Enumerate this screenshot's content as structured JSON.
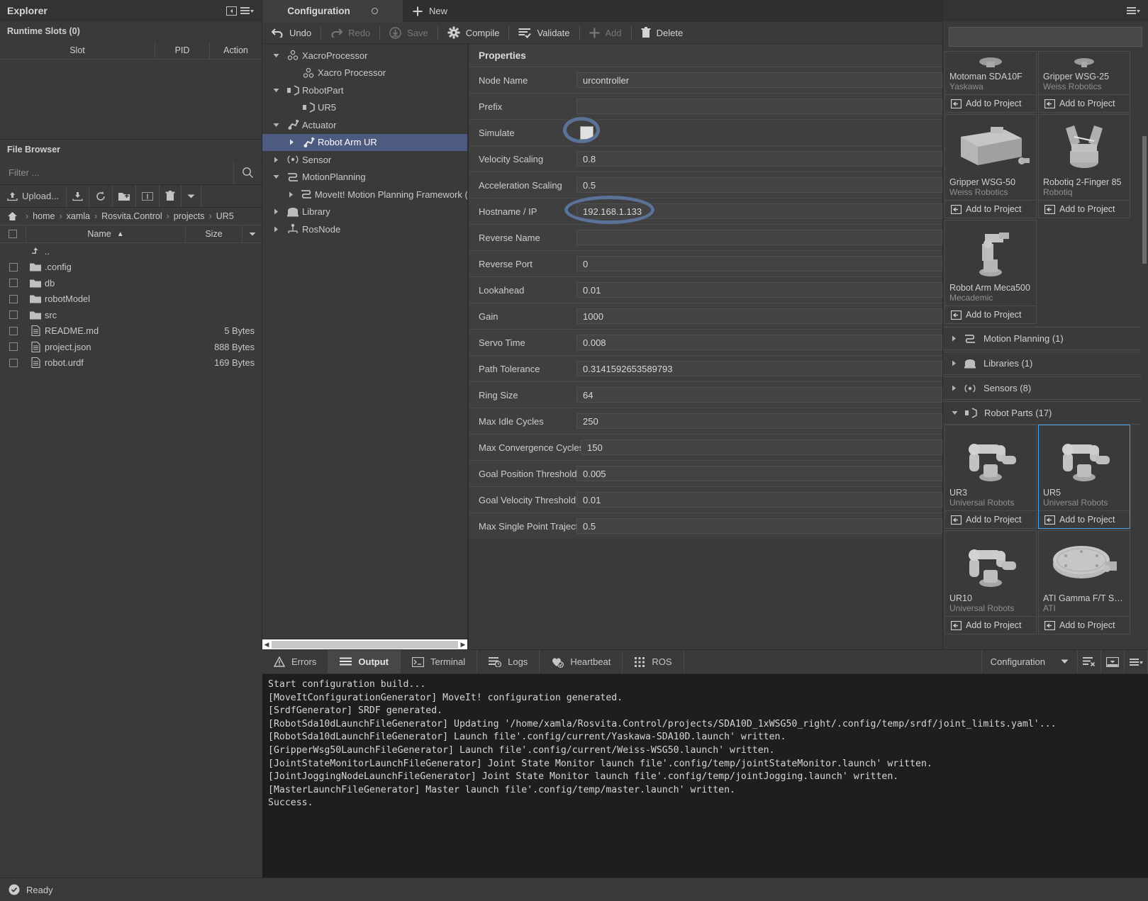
{
  "explorer": {
    "title": "Explorer",
    "collapse_icon": "collapse-panel-icon",
    "menu_icon": "hamburger-menu-icon",
    "runtime_slots": {
      "title": "Runtime Slots (0)",
      "columns": [
        "Slot",
        "PID",
        "Action"
      ],
      "rows": []
    },
    "file_browser": {
      "title": "File Browser",
      "filter_placeholder": "Filter ...",
      "toolbar": {
        "upload_label": "Upload...",
        "icons": [
          "upload-icon",
          "download-icon",
          "refresh-icon",
          "new-folder-icon",
          "rename-icon",
          "delete-icon",
          "chevron-down-icon"
        ]
      },
      "breadcrumb": [
        "home",
        "xamla",
        "Rosvita.Control",
        "projects",
        "UR5"
      ],
      "columns": [
        "Name",
        "Size"
      ],
      "sort_indicator": "▲",
      "rows": [
        {
          "name": "..",
          "size": "",
          "kind": "up"
        },
        {
          "name": ".config",
          "size": "",
          "kind": "folder"
        },
        {
          "name": "db",
          "size": "",
          "kind": "folder"
        },
        {
          "name": "robotModel",
          "size": "",
          "kind": "folder"
        },
        {
          "name": "src",
          "size": "",
          "kind": "folder"
        },
        {
          "name": "README.md",
          "size": "5 Bytes",
          "kind": "file"
        },
        {
          "name": "project.json",
          "size": "888 Bytes",
          "kind": "file"
        },
        {
          "name": "robot.urdf",
          "size": "169 Bytes",
          "kind": "file"
        }
      ]
    }
  },
  "tabs": {
    "items": [
      {
        "label": "Configuration",
        "modified": true
      }
    ],
    "new_label": "New"
  },
  "toolbar": {
    "items": [
      {
        "label": "Undo",
        "icon": "undo-icon",
        "disabled": false
      },
      {
        "label": "Redo",
        "icon": "redo-icon",
        "disabled": true
      },
      {
        "label": "Save",
        "icon": "save-icon",
        "disabled": true
      },
      {
        "label": "Compile",
        "icon": "compile-icon",
        "disabled": false
      },
      {
        "label": "Validate",
        "icon": "validate-icon",
        "disabled": false
      },
      {
        "label": "Add",
        "icon": "add-icon",
        "disabled": true
      },
      {
        "label": "Delete",
        "icon": "delete-icon",
        "disabled": false
      }
    ]
  },
  "tree": {
    "nodes": [
      {
        "label": "XacroProcessor",
        "icon": "xacro-icon",
        "indent": 0,
        "twisty": "down",
        "selected": false
      },
      {
        "label": "Xacro Processor",
        "icon": "xacro-icon",
        "indent": 1,
        "twisty": "none",
        "selected": false
      },
      {
        "label": "RobotPart",
        "icon": "robot-part-icon",
        "indent": 0,
        "twisty": "down",
        "selected": false
      },
      {
        "label": "UR5",
        "icon": "robot-part-icon",
        "indent": 1,
        "twisty": "none",
        "selected": false
      },
      {
        "label": "Actuator",
        "icon": "actuator-icon",
        "indent": 0,
        "twisty": "down",
        "selected": false
      },
      {
        "label": "Robot Arm UR",
        "icon": "actuator-icon",
        "indent": 1,
        "twisty": "right",
        "selected": true
      },
      {
        "label": "Sensor",
        "icon": "sensor-icon",
        "indent": 0,
        "twisty": "right",
        "selected": false
      },
      {
        "label": "MotionPlanning",
        "icon": "motion-planning-icon",
        "indent": 0,
        "twisty": "down",
        "selected": false
      },
      {
        "label": "MoveIt! Motion Planning Framework (RO",
        "icon": "motion-planning-icon",
        "indent": 1,
        "twisty": "right",
        "selected": false
      },
      {
        "label": "Library",
        "icon": "library-icon",
        "indent": 0,
        "twisty": "right",
        "selected": false
      },
      {
        "label": "RosNode",
        "icon": "rosnode-icon",
        "indent": 0,
        "twisty": "right",
        "selected": false
      }
    ]
  },
  "properties": {
    "title": "Properties",
    "rows": [
      {
        "label": "Node Name",
        "value": "urcontroller",
        "type": "text"
      },
      {
        "label": "Prefix",
        "value": "",
        "type": "text"
      },
      {
        "label": "Simulate",
        "value": "",
        "type": "checkbox",
        "checked": false
      },
      {
        "label": "Velocity Scaling",
        "value": "0.8",
        "type": "text"
      },
      {
        "label": "Acceleration Scaling",
        "value": "0.5",
        "type": "text"
      },
      {
        "label": "Hostname / IP",
        "value": "192.168.1.133",
        "type": "text"
      },
      {
        "label": "Reverse Name",
        "value": "",
        "type": "text"
      },
      {
        "label": "Reverse Port",
        "value": "0",
        "type": "text"
      },
      {
        "label": "Lookahead",
        "value": "0.01",
        "type": "text"
      },
      {
        "label": "Gain",
        "value": "1000",
        "type": "text"
      },
      {
        "label": "Servo Time",
        "value": "0.008",
        "type": "text"
      },
      {
        "label": "Path Tolerance",
        "value": "0.3141592653589793",
        "type": "text"
      },
      {
        "label": "Ring Size",
        "value": "64",
        "type": "text"
      },
      {
        "label": "Max Idle Cycles",
        "value": "250",
        "type": "text"
      },
      {
        "label": "Max Convergence Cycles",
        "value": "150",
        "type": "text"
      },
      {
        "label": "Goal Position Threshold (r",
        "value": "0.005",
        "type": "text"
      },
      {
        "label": "Goal Velocity Threshold (ra",
        "value": "0.01",
        "type": "text"
      },
      {
        "label": "Max Single Point Trajector",
        "value": "0.5",
        "type": "text"
      }
    ]
  },
  "annotations": {
    "accent_color": "#5a7198",
    "marks": [
      "simulate-checkbox-highlight",
      "hostname-ip-highlight"
    ]
  },
  "library": {
    "menu_icon": "hamburger-menu-icon",
    "search_value": "",
    "search_placeholder": "",
    "add_label": "Add to Project",
    "cards_top": [
      {
        "name": "Motoman SDA10F",
        "vendor": "Yaskawa",
        "thumb": "robot-arm-thumb",
        "clipped": true,
        "selected": false
      },
      {
        "name": "Gripper WSG-25",
        "vendor": "Weiss Robotics",
        "thumb": "gripper-thumb",
        "clipped": true,
        "selected": false
      },
      {
        "name": "Gripper WSG-50",
        "vendor": "Weiss Robotics",
        "thumb": "gripper-box-thumb",
        "clipped": false,
        "selected": false
      },
      {
        "name": "Robotiq 2-Finger 85",
        "vendor": "Robotiq",
        "thumb": "two-finger-gripper-thumb",
        "clipped": false,
        "selected": false
      },
      {
        "name": "Robot Arm Meca500",
        "vendor": "Mecademic",
        "thumb": "meca500-thumb",
        "clipped": false,
        "selected": false
      }
    ],
    "categories": [
      {
        "label": "Motion Planning (1)",
        "icon": "motion-planning-icon",
        "expanded": false
      },
      {
        "label": "Libraries (1)",
        "icon": "library-icon",
        "expanded": false
      },
      {
        "label": "Sensors (8)",
        "icon": "sensor-icon",
        "expanded": false
      },
      {
        "label": "Robot Parts (17)",
        "icon": "robot-part-icon",
        "expanded": true
      }
    ],
    "cards_parts": [
      {
        "name": "UR3",
        "vendor": "Universal Robots",
        "thumb": "ur-arm-thumb",
        "selected": false
      },
      {
        "name": "UR5",
        "vendor": "Universal Robots",
        "thumb": "ur-arm-thumb",
        "selected": true
      },
      {
        "name": "UR10",
        "vendor": "Universal Robots",
        "thumb": "ur-arm-thumb",
        "selected": false
      },
      {
        "name": "ATI Gamma F/T Sens…",
        "vendor": "ATI",
        "thumb": "ft-sensor-thumb",
        "selected": false
      }
    ]
  },
  "bottom_panel": {
    "tabs": [
      {
        "label": "Errors",
        "icon": "warning-icon",
        "active": false
      },
      {
        "label": "Output",
        "icon": "output-icon",
        "active": true
      },
      {
        "label": "Terminal",
        "icon": "terminal-icon",
        "active": false
      },
      {
        "label": "Logs",
        "icon": "logs-icon",
        "active": false
      },
      {
        "label": "Heartbeat",
        "icon": "heartbeat-icon",
        "active": false
      },
      {
        "label": "ROS",
        "icon": "ros-grid-icon",
        "active": false
      }
    ],
    "selector_label": "Configuration",
    "selector_icon": "chevron-down-icon",
    "action_icons": [
      "clear-output-icon",
      "minimize-panel-icon",
      "panel-menu-icon"
    ],
    "console_lines": [
      "Start configuration build...",
      "[MoveItConfigurationGenerator] MoveIt! configuration generated.",
      "[SrdfGenerator] SRDF generated.",
      "[RobotSda10dLaunchFileGenerator] Updating '/home/xamla/Rosvita.Control/projects/SDA10D_1xWSG50_right/.config/temp/srdf/joint_limits.yaml'...",
      "[RobotSda10dLaunchFileGenerator] Launch file'.config/current/Yaskawa-SDA10D.launch' written.",
      "[GripperWsg50LaunchFileGenerator] Launch file'.config/current/Weiss-WSG50.launch' written.",
      "[JointStateMonitorLaunchFileGenerator] Joint State Monitor launch file'.config/temp/jointStateMonitor.launch' written.",
      "[JointJoggingNodeLaunchFileGenerator] Joint State Monitor launch file'.config/temp/jointJogging.launch' written.",
      "[MasterLaunchFileGenerator] Master launch file'.config/temp/master.launch' written.",
      "Success."
    ]
  },
  "statusbar": {
    "icon": "check-circle-icon",
    "text": "Ready"
  }
}
